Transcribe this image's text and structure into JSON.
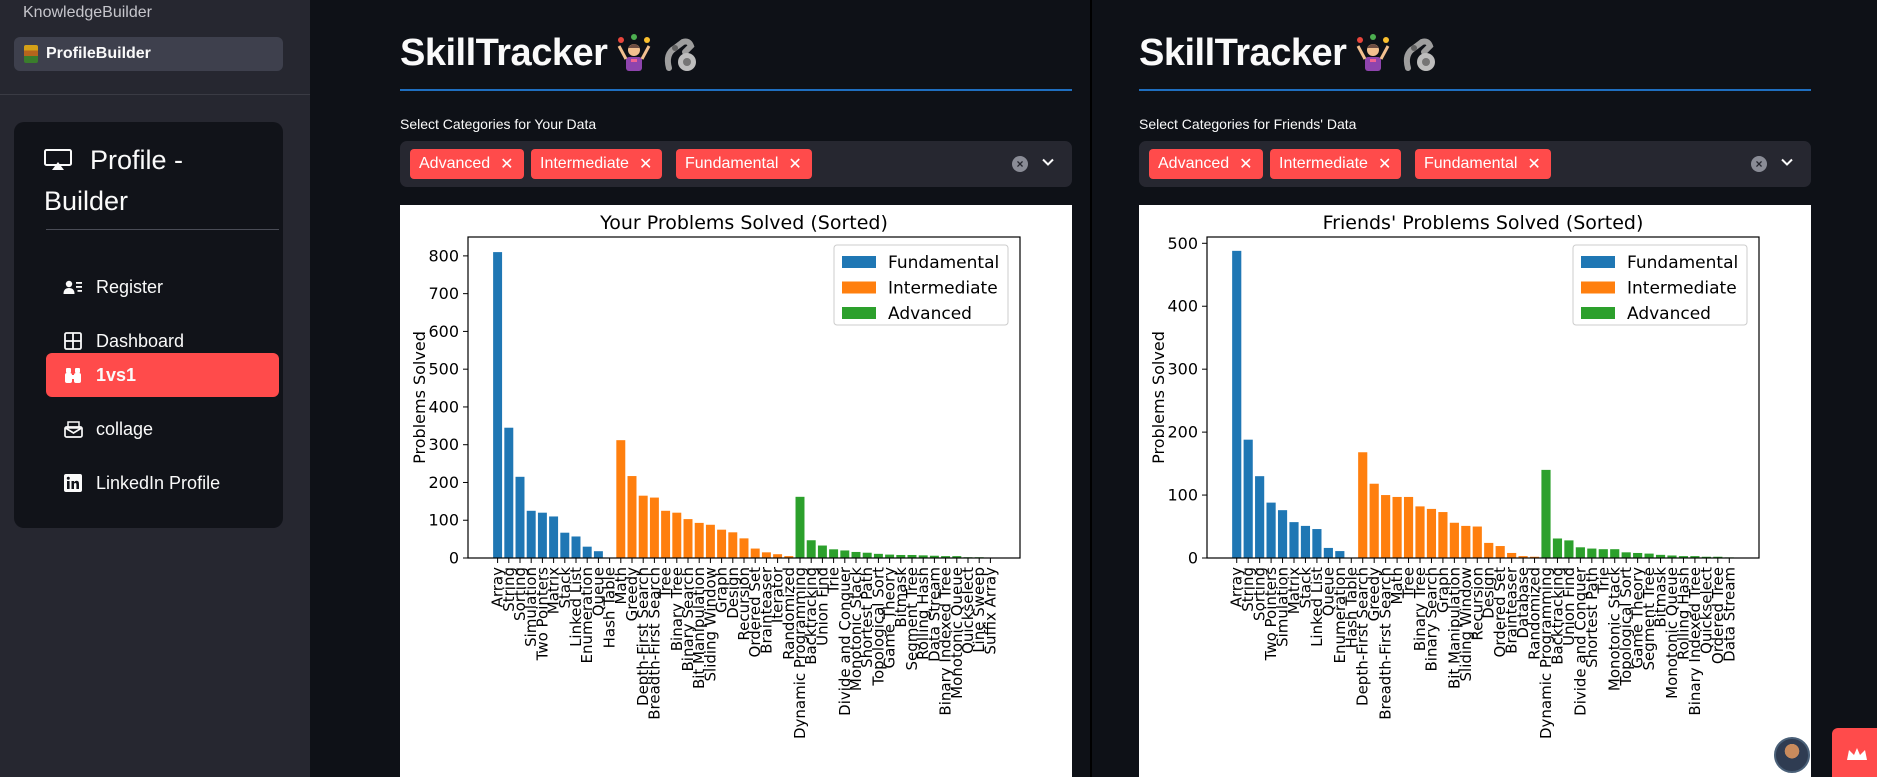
{
  "sidebar": {
    "apps": [
      {
        "label": "KnowledgeBuilder"
      },
      {
        "label": "ProfileBuilder"
      }
    ],
    "menu_title": "Profile - Builder",
    "menu_items": [
      {
        "label": "Register",
        "icon": "person-lines-icon"
      },
      {
        "label": "Dashboard",
        "icon": "grid-icon"
      },
      {
        "label": "1vs1",
        "icon": "binoculars-icon"
      },
      {
        "label": "collage",
        "icon": "envelope-paper-icon"
      },
      {
        "label": "LinkedIn Profile",
        "icon": "linkedin-icon"
      }
    ],
    "active_index": 2
  },
  "panels": {
    "left": {
      "title": "SkillTracker",
      "select_label": "Select Categories for Your Data",
      "tags": [
        "Advanced",
        "Intermediate",
        "Fundamental"
      ]
    },
    "right": {
      "title": "SkillTracker",
      "select_label": "Select Categories for Friends' Data",
      "tags": [
        "Advanced",
        "Intermediate",
        "Fundamental"
      ]
    }
  },
  "colors": {
    "accent": "#ff4b4b",
    "fundamental": "#1f77b4",
    "intermediate": "#ff7f0e",
    "advanced": "#2ca02c"
  },
  "chart_data": [
    {
      "type": "bar",
      "title": "Your Problems Solved (Sorted)",
      "ylabel": "Problems Solved",
      "ylim": [
        0,
        850
      ],
      "yticks": [
        0,
        100,
        200,
        300,
        400,
        500,
        600,
        700,
        800
      ],
      "legend": [
        "Fundamental",
        "Intermediate",
        "Advanced"
      ],
      "legend_position": "top-right",
      "series": [
        {
          "name": "Fundamental",
          "categories": [
            "Array",
            "String",
            "Sorting",
            "Simulation",
            "Two Pointers",
            "Matrix",
            "Stack",
            "Linked List",
            "Enumeration",
            "Queue",
            "Hash Table"
          ],
          "values": [
            810,
            345,
            215,
            125,
            120,
            110,
            67,
            57,
            30,
            18,
            0
          ]
        },
        {
          "name": "Intermediate",
          "categories": [
            "Math",
            "Greedy",
            "Depth-First Search",
            "Breadth-First Search",
            "Tree",
            "Binary Tree",
            "Binary Search",
            "Bit Manipulation",
            "Sliding Window",
            "Graph",
            "Design",
            "Recursion",
            "Ordered Set",
            "Brainteaser",
            "Iterator",
            "Randomized"
          ],
          "values": [
            312,
            217,
            165,
            160,
            125,
            120,
            103,
            93,
            88,
            75,
            68,
            52,
            25,
            15,
            10,
            5
          ]
        },
        {
          "name": "Advanced",
          "categories": [
            "Dynamic Programming",
            "Backtracking",
            "Union Find",
            "Trie",
            "Divide and Conquer",
            "Monotonic Stack",
            "Shortest Path",
            "Topological Sort",
            "Game Theory",
            "Bitmask",
            "Segment Tree",
            "Rolling Hash",
            "Data Stream",
            "Binary Indexed Tree",
            "Monotonic Queue",
            "Quickselect",
            "Line Sweep",
            "Suffix Array"
          ],
          "values": [
            162,
            47,
            33,
            23,
            20,
            16,
            14,
            11,
            9,
            8,
            8,
            7,
            6,
            5,
            5,
            2,
            2,
            1
          ]
        }
      ]
    },
    {
      "type": "bar",
      "title": "Friends' Problems Solved (Sorted)",
      "ylabel": "Problems Solved",
      "ylim": [
        0,
        510
      ],
      "yticks": [
        0,
        100,
        200,
        300,
        400,
        500
      ],
      "legend": [
        "Fundamental",
        "Intermediate",
        "Advanced"
      ],
      "legend_position": "top-right",
      "series": [
        {
          "name": "Fundamental",
          "categories": [
            "Array",
            "String",
            "Sorting",
            "Two Pointers",
            "Simulation",
            "Matrix",
            "Stack",
            "Linked List",
            "Queue",
            "Enumeration",
            "Hash Table"
          ],
          "values": [
            488,
            188,
            130,
            88,
            76,
            57,
            51,
            46,
            16,
            11,
            0
          ]
        },
        {
          "name": "Intermediate",
          "categories": [
            "Depth-First Search",
            "Greedy",
            "Breadth-First Search",
            "Math",
            "Tree",
            "Binary Tree",
            "Binary Search",
            "Graph",
            "Bit Manipulation",
            "Sliding Window",
            "Recursion",
            "Design",
            "Ordered Set",
            "Brainteaser",
            "Database",
            "Randomized"
          ],
          "values": [
            168,
            118,
            100,
            97,
            97,
            82,
            78,
            73,
            56,
            51,
            50,
            24,
            19,
            8,
            3,
            2
          ]
        },
        {
          "name": "Advanced",
          "categories": [
            "Dynamic Programming",
            "Backtracking",
            "Union Find",
            "Divide and Conquer",
            "Shortest Path",
            "Trie",
            "Monotonic Stack",
            "Topological Sort",
            "Game Theory",
            "Segment Tree",
            "Bitmask",
            "Monotonic Queue",
            "Rolling Hash",
            "Binary Indexed Tree",
            "Quickselect",
            "Ordered Tree",
            "Data Stream"
          ],
          "values": [
            140,
            31,
            28,
            17,
            15,
            14,
            14,
            9,
            8,
            7,
            5,
            4,
            3,
            3,
            2,
            2,
            1
          ]
        }
      ]
    }
  ]
}
